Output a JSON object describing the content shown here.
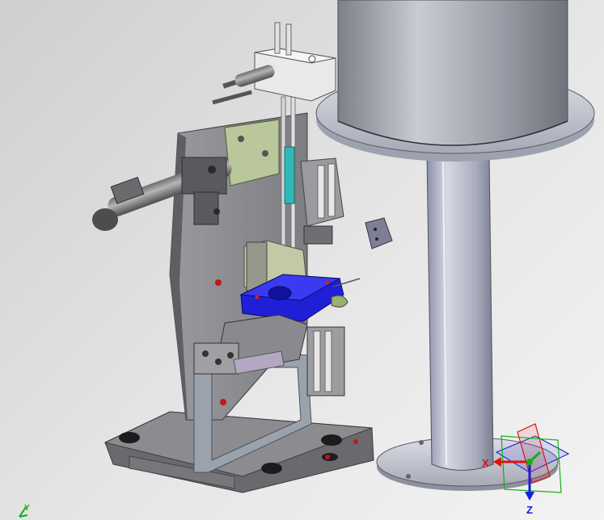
{
  "viewport": {
    "background_top": "#cfcfcf",
    "background_bottom": "#f3f3f3"
  },
  "colors": {
    "plate_gray": "#8a8a8a",
    "base_dark": "#5c5c5c",
    "cylinder_silver": "#b8bcc4",
    "clamp_blue": "#1f1fd8",
    "sensor_cyan": "#2fb8b8",
    "bracket_green": "#b9c79a",
    "axis_x": "#e01010",
    "axis_y": "#10b010",
    "axis_z": "#1020e0"
  },
  "compass": {
    "x_label": "X",
    "z_label": "Z"
  },
  "corner_triad": {
    "y_label": "Y",
    "icon": "mini-axis-triad-icon"
  }
}
